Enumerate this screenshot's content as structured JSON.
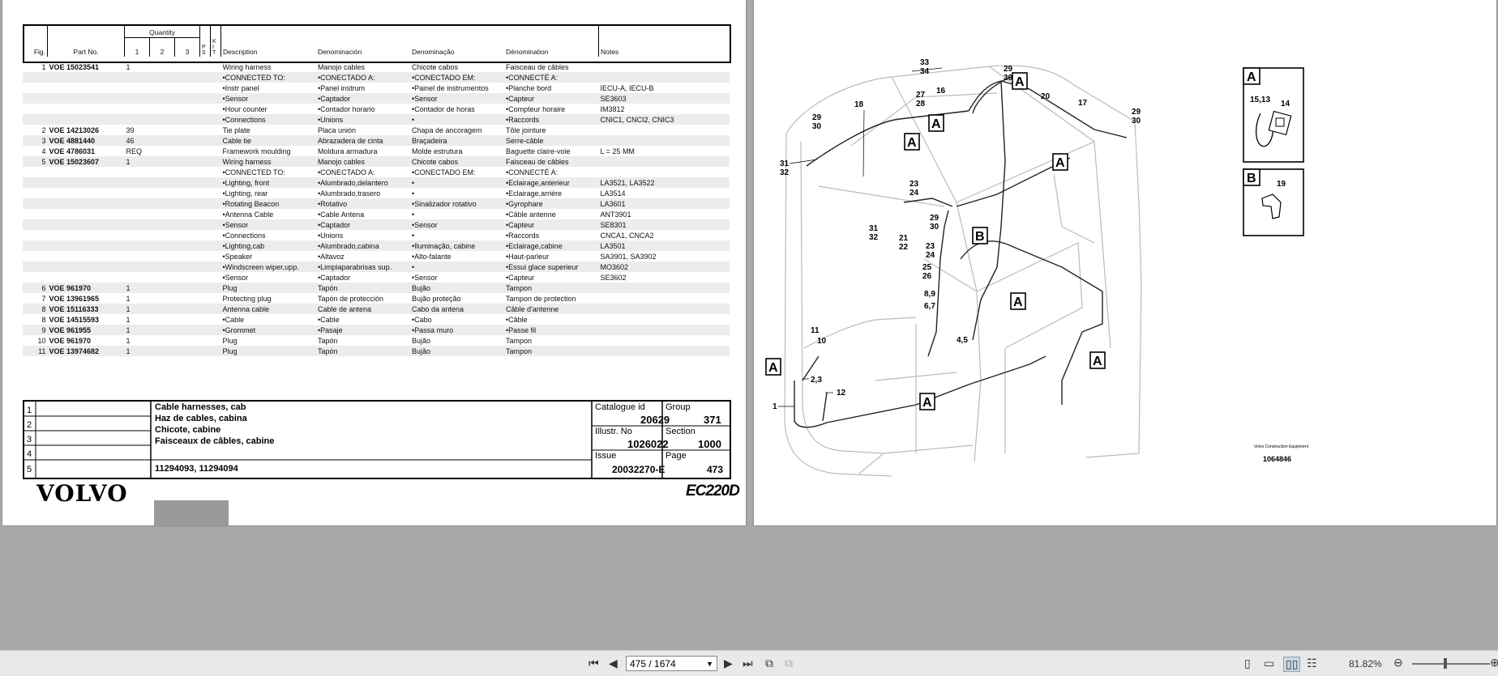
{
  "table_headers": {
    "fig": "Fig.",
    "part_no": "Part No.",
    "quantity": "Quantity",
    "q1": "1",
    "q2": "2",
    "q3": "3",
    "ps": "P S",
    "kit": "K I T",
    "description": "Description",
    "denominacion": "Denominación",
    "denominacao": "Denominação",
    "denomination": "Dénomination",
    "notes": "Notes"
  },
  "rows": [
    {
      "fig": "1",
      "part": "VOE 15023541",
      "qty": "1",
      "desc": "Wiring harness",
      "es": "Manojo cables",
      "pt": "Chicote cabos",
      "fr": "Faisceau de câbles",
      "notes": ""
    },
    {
      "fig": "",
      "part": "",
      "qty": "",
      "desc": "•CONNECTED TO:",
      "es": "•CONECTADO A:",
      "pt": "•CONECTADO EM:",
      "fr": "•CONNECTÉ A:",
      "notes": ""
    },
    {
      "fig": "",
      "part": "",
      "qty": "",
      "desc": "•Instr panel",
      "es": "•Panel instrum",
      "pt": "•Painel de instrumentos",
      "fr": "•Planche bord",
      "notes": "IECU-A, IECU-B"
    },
    {
      "fig": "",
      "part": "",
      "qty": "",
      "desc": "•Sensor",
      "es": "•Captador",
      "pt": "•Sensor",
      "fr": "•Capteur",
      "notes": "SE3603"
    },
    {
      "fig": "",
      "part": "",
      "qty": "",
      "desc": "•Hour counter",
      "es": "•Contador horario",
      "pt": "•Contador de horas",
      "fr": "•Compteur horaire",
      "notes": "IM3812"
    },
    {
      "fig": "",
      "part": "",
      "qty": "",
      "desc": "•Connections",
      "es": "•Unions",
      "pt": "•",
      "fr": "•Raccords",
      "notes": "CNIC1, CNCI2, CNIC3"
    },
    {
      "fig": "2",
      "part": "VOE 14213026",
      "qty": "39",
      "desc": "Tie plate",
      "es": "Placa unión",
      "pt": "Chapa de ancoragem",
      "fr": "Tôle jointure",
      "notes": ""
    },
    {
      "fig": "3",
      "part": "VOE 4881440",
      "qty": "46",
      "desc": "Cable tie",
      "es": "Abrazadera de cinta",
      "pt": "Braçadeira",
      "fr": "Serre-câble",
      "notes": ""
    },
    {
      "fig": "4",
      "part": "VOE 4786031",
      "qty": "REQ",
      "desc": "Framework moulding",
      "es": "Moldura armadura",
      "pt": "Molde estrutura",
      "fr": "Baguette claire-voie",
      "notes": "L = 25 MM"
    },
    {
      "fig": "5",
      "part": "VOE 15023607",
      "qty": "1",
      "desc": "Wiring harness",
      "es": "Manojo cables",
      "pt": "Chicote cabos",
      "fr": "Faisceau de câbles",
      "notes": ""
    },
    {
      "fig": "",
      "part": "",
      "qty": "",
      "desc": "•CONNECTED TO:",
      "es": "•CONECTADO A:",
      "pt": "•CONECTADO EM:",
      "fr": "•CONNECTÉ A:",
      "notes": ""
    },
    {
      "fig": "",
      "part": "",
      "qty": "",
      "desc": "•Lighting, front",
      "es": "•Alumbrado,delantero",
      "pt": "•",
      "fr": "•Eclairage,anterieur",
      "notes": "LA3521, LA3522"
    },
    {
      "fig": "",
      "part": "",
      "qty": "",
      "desc": "•Lighting, rear",
      "es": "•Alumbrado,trasero",
      "pt": "•",
      "fr": "•Eclairage,arrière",
      "notes": "LA3514"
    },
    {
      "fig": "",
      "part": "",
      "qty": "",
      "desc": "•Rotating Beacon",
      "es": "•Rotativo",
      "pt": "•Sinalizador rotativo",
      "fr": "•Gyrophare",
      "notes": "LA3601"
    },
    {
      "fig": "",
      "part": "",
      "qty": "",
      "desc": "•Antenna Cable",
      "es": "•Cable Antena",
      "pt": "•",
      "fr": "•Câble antenne",
      "notes": "ANT3901"
    },
    {
      "fig": "",
      "part": "",
      "qty": "",
      "desc": "•Sensor",
      "es": "•Captador",
      "pt": "•Sensor",
      "fr": "•Capteur",
      "notes": "SE8301"
    },
    {
      "fig": "",
      "part": "",
      "qty": "",
      "desc": "•Connections",
      "es": "•Unions",
      "pt": "•",
      "fr": "•Raccords",
      "notes": "CNCA1, CNCA2"
    },
    {
      "fig": "",
      "part": "",
      "qty": "",
      "desc": "•Lighting,cab",
      "es": "•Alumbrado,cabina",
      "pt": "•Iluminação, cabine",
      "fr": "•Eclairage,cabine",
      "notes": "LA3501"
    },
    {
      "fig": "",
      "part": "",
      "qty": "",
      "desc": "•Speaker",
      "es": "•Altavoz",
      "pt": "•Alto-falante",
      "fr": "•Haut-parleur",
      "notes": "SA3901, SA3902"
    },
    {
      "fig": "",
      "part": "",
      "qty": "",
      "desc": "•Windscreen wiper,upp.",
      "es": "•Limpiaparabrisas sup.",
      "pt": "•",
      "fr": "•Essui glace superieur",
      "notes": "MO3602"
    },
    {
      "fig": "",
      "part": "",
      "qty": "",
      "desc": "•Sensor",
      "es": "•Captador",
      "pt": "•Sensor",
      "fr": "•Capteur",
      "notes": "SE3602"
    },
    {
      "fig": "6",
      "part": "VOE 961970",
      "qty": "1",
      "desc": "Plug",
      "es": "Tapón",
      "pt": "Bujão",
      "fr": "Tampon",
      "notes": ""
    },
    {
      "fig": "7",
      "part": "VOE 13961965",
      "qty": "1",
      "desc": "Protecting plug",
      "es": "Tapón de protección",
      "pt": "Bujão proteção",
      "fr": "Tampon de protection",
      "notes": ""
    },
    {
      "fig": "8",
      "part": "VOE 15116333",
      "qty": "1",
      "desc": "Antenna cable",
      "es": "Cable de antena",
      "pt": "Cabo da antena",
      "fr": "Câble d'antenne",
      "notes": ""
    },
    {
      "fig": "8",
      "part": "VOE 14515593",
      "qty": "1",
      "desc": "•Cable",
      "es": "•Cable",
      "pt": "•Cabo",
      "fr": "•Câble",
      "notes": ""
    },
    {
      "fig": "9",
      "part": "VOE 961955",
      "qty": "1",
      "desc": "•Grommet",
      "es": "•Pasaje",
      "pt": "•Passa muro",
      "fr": "•Passe fil",
      "notes": ""
    },
    {
      "fig": "10",
      "part": "VOE 961970",
      "qty": "1",
      "desc": "Plug",
      "es": "Tapón",
      "pt": "Bujão",
      "fr": "Tampon",
      "notes": ""
    },
    {
      "fig": "11",
      "part": "VOE 13974682",
      "qty": "1",
      "desc": "Plug",
      "es": "Tapón",
      "pt": "Bujão",
      "fr": "Tampon",
      "notes": ""
    }
  ],
  "footer": {
    "rows": [
      "1",
      "2",
      "3",
      "4",
      "5"
    ],
    "title_en": "Cable harnesses, cab",
    "title_es": "Haz de cables, cabina",
    "title_pt": "Chicote, cabine",
    "title_fr": "Faisceaux de câbles, cabine",
    "serials": "11294093, 11294094",
    "catalogue_label": "Catalogue id",
    "catalogue_value": "20629",
    "group_label": "Group",
    "group_value": "371",
    "illustr_label": "Illustr. No",
    "illustr_value": "1026022",
    "section_label": "Section",
    "section_value": "1000",
    "issue_label": "Issue",
    "issue_value": "20032270-E",
    "page_label": "Page",
    "page_value": "473"
  },
  "brand": "VOLVO",
  "model": "EC220D",
  "diagram": {
    "inset_a_label": "A",
    "inset_a_parts": [
      "15,13",
      "14"
    ],
    "inset_b_label": "B",
    "inset_b_part": "19",
    "footer_company": "Volvo Construction Equipment",
    "footer_number": "1064846"
  },
  "toolbar": {
    "page_indicator": "475 / 1674",
    "zoom": "81.82%"
  }
}
